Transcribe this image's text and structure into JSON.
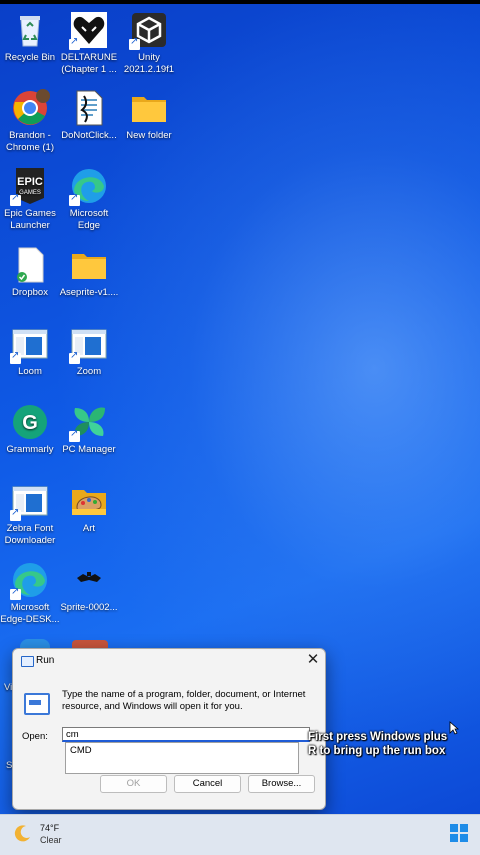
{
  "desktop_icons": [
    {
      "label": "Recycle Bin",
      "icon": "recycle-bin-icon"
    },
    {
      "label": "DELTARUNE (Chapter 1 ...",
      "icon": "deltarune-heart-icon"
    },
    {
      "label": "Unity 2021.2.19f1",
      "icon": "unity-icon"
    },
    {
      "label": "Brandon - Chrome (1)",
      "icon": "chrome-icon"
    },
    {
      "label": "DoNotClick...",
      "icon": "document-icon"
    },
    {
      "label": "New folder",
      "icon": "folder-icon"
    },
    {
      "label": "Epic Games Launcher",
      "icon": "epic-games-icon"
    },
    {
      "label": "Microsoft Edge",
      "icon": "edge-icon"
    },
    {
      "label": "Dropbox",
      "icon": "file-icon"
    },
    {
      "label": "Aseprite-v1....",
      "icon": "folder-icon"
    },
    {
      "label": "Loom",
      "icon": "app-window-icon"
    },
    {
      "label": "Zoom",
      "icon": "app-window-icon"
    },
    {
      "label": "Grammarly",
      "icon": "grammarly-icon"
    },
    {
      "label": "PC Manager",
      "icon": "pc-manager-icon"
    },
    {
      "label": "Zebra Font Downloader",
      "icon": "app-window-icon"
    },
    {
      "label": "Art",
      "icon": "art-folder-icon"
    },
    {
      "label": "Microsoft Edge-DESK...",
      "icon": "edge-icon"
    },
    {
      "label": "Sprite-0002...",
      "icon": "sprite-icon"
    }
  ],
  "run_dialog": {
    "title": "Run",
    "description": "Type the name of a program, folder, document, or Internet resource, and Windows will open it for you.",
    "open_label": "Open:",
    "open_value": "cm",
    "suggestion": "CMD",
    "ok_label": "OK",
    "cancel_label": "Cancel",
    "browse_label": "Browse..."
  },
  "caption": "First press Windows plus R to bring up the run box",
  "taskbar": {
    "temperature": "74°F",
    "condition": "Clear",
    "weather_icon": "moon-icon",
    "start_icon": "windows-start-icon"
  },
  "colors": {
    "wallpaper": "#0f5ae6",
    "accent": "#1e5bd6",
    "taskbar": "#dfe6f0"
  }
}
